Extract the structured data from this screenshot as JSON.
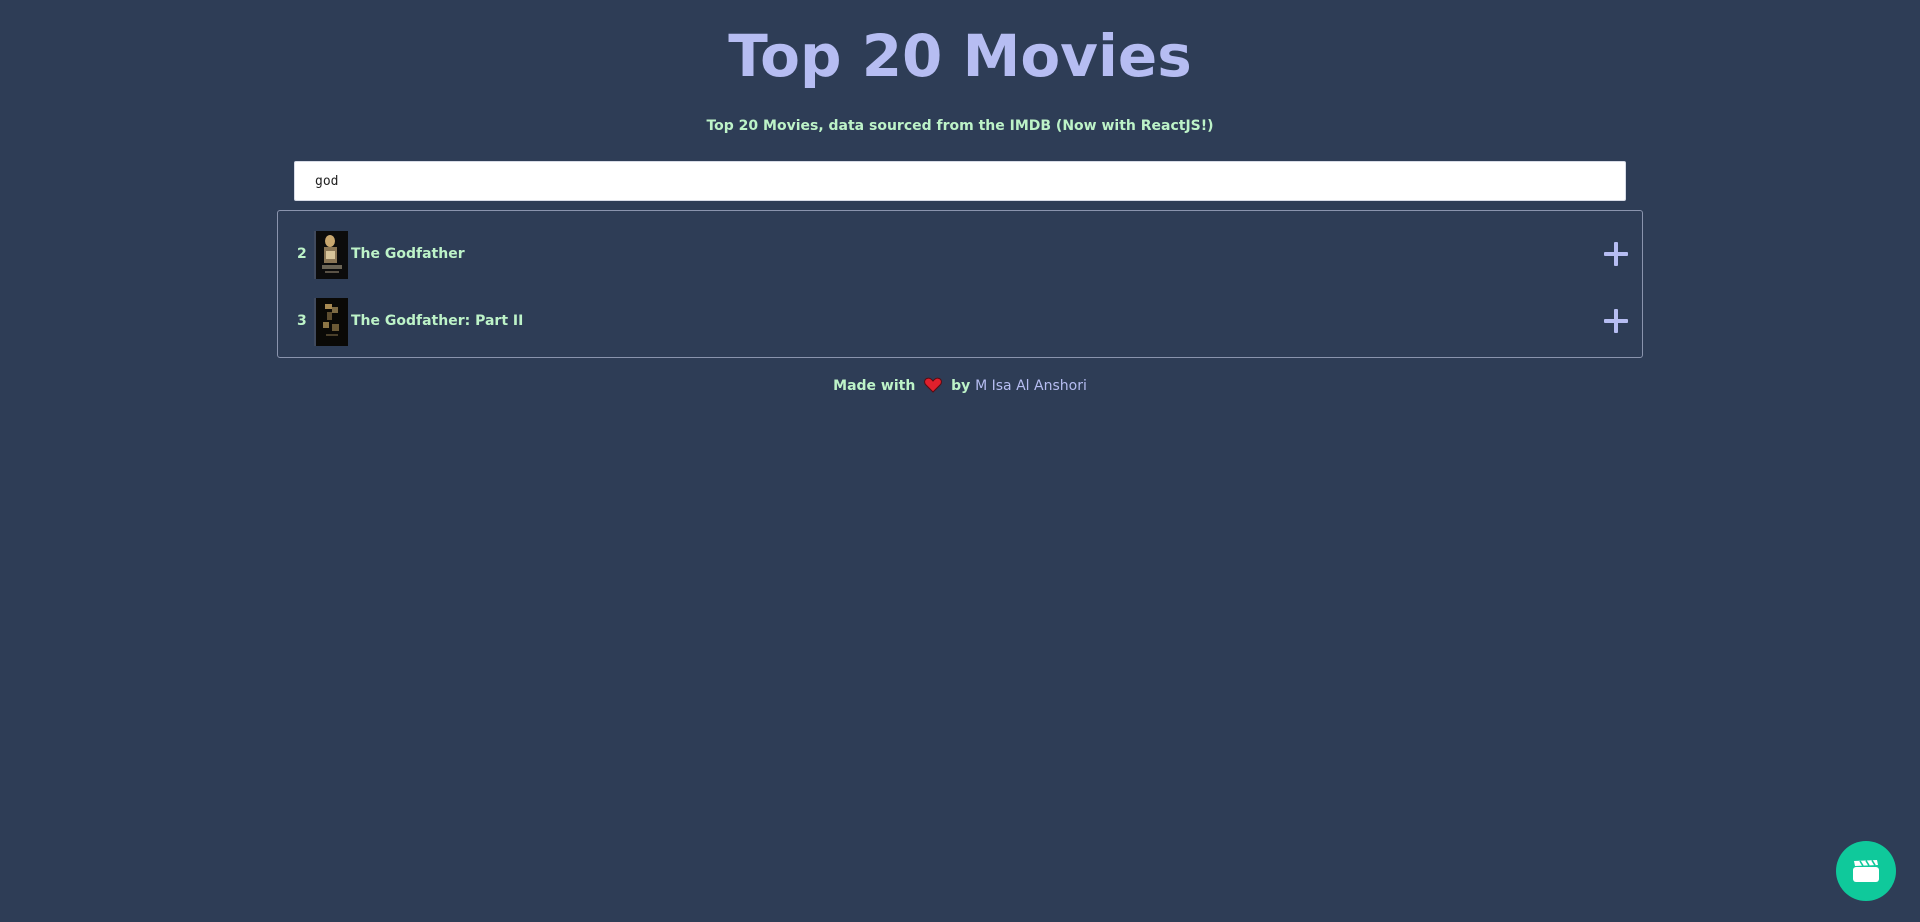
{
  "header": {
    "title": "Top 20 Movies",
    "subtitle": "Top 20 Movies, data sourced from the IMDB (Now with ReactJS!)"
  },
  "search": {
    "value": "god"
  },
  "results": [
    {
      "rank": "2",
      "title": "The Godfather"
    },
    {
      "rank": "3",
      "title": "The Godfather: Part II"
    }
  ],
  "footer": {
    "made_with": "Made with",
    "by": "by",
    "author": "M Isa Al Anshori"
  },
  "colors": {
    "background": "#2e3d56",
    "title": "#b6bdf2",
    "text_green": "#bdf3c8",
    "fab": "#0fc99b"
  },
  "icons": {
    "expand": "plus-icon",
    "heart": "heart-icon",
    "fab": "clapperboard-icon"
  }
}
